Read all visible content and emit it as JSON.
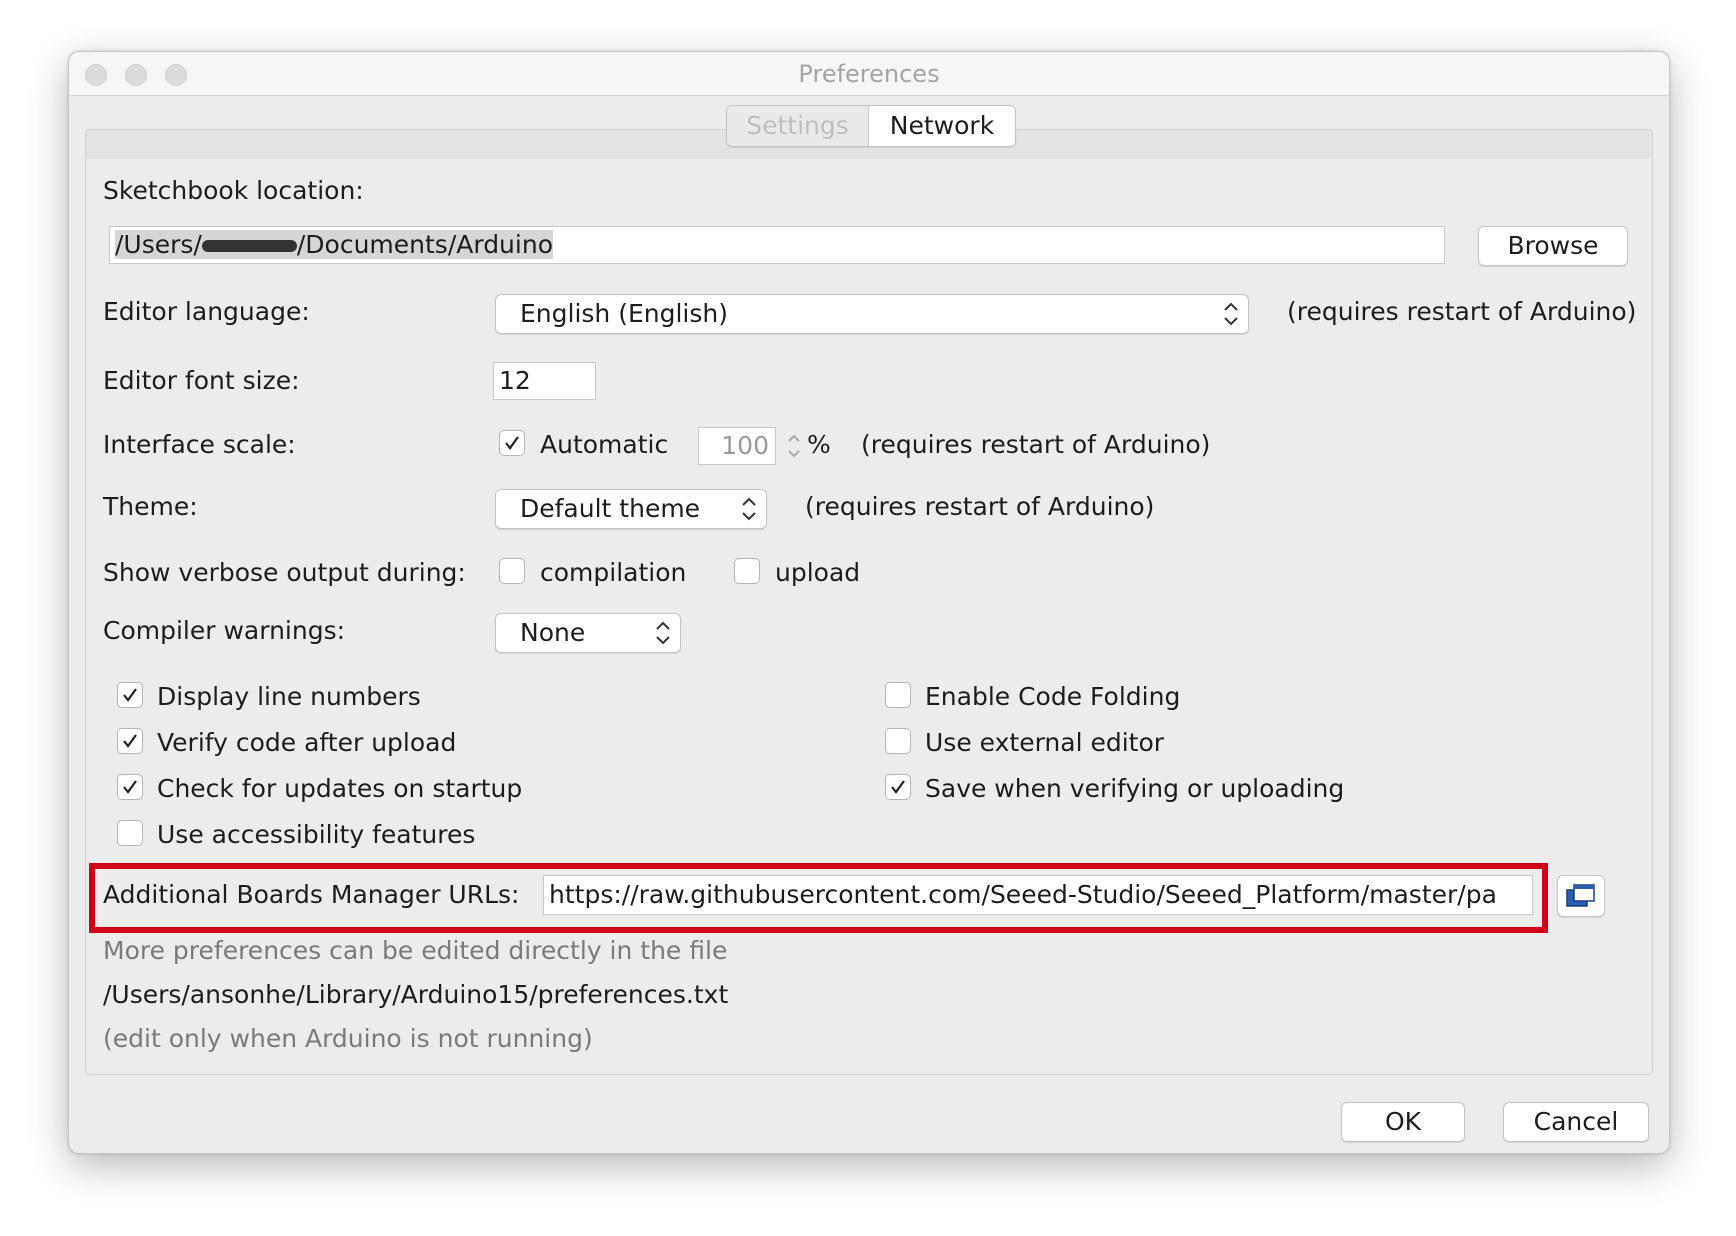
{
  "window": {
    "title": "Preferences"
  },
  "tabs": [
    {
      "label": "Settings",
      "active": false
    },
    {
      "label": "Network",
      "active": true
    }
  ],
  "sketchbook": {
    "label": "Sketchbook location:",
    "path_prefix": "/Users/",
    "path_suffix": "/Documents/Arduino",
    "browse_label": "Browse"
  },
  "editor_language": {
    "label": "Editor language:",
    "value": "English (English)",
    "note": "(requires restart of Arduino)"
  },
  "font_size": {
    "label": "Editor font size:",
    "value": "12"
  },
  "interface_scale": {
    "label": "Interface scale:",
    "automatic_label": "Automatic",
    "automatic_checked": true,
    "value": "100",
    "unit": "%",
    "note": "(requires restart of Arduino)"
  },
  "theme": {
    "label": "Theme:",
    "value": "Default theme",
    "note": "(requires restart of Arduino)"
  },
  "verbose": {
    "label": "Show verbose output during:",
    "compilation_label": "compilation",
    "compilation_checked": false,
    "upload_label": "upload",
    "upload_checked": false
  },
  "compiler_warnings": {
    "label": "Compiler warnings:",
    "value": "None"
  },
  "options_left": [
    {
      "label": "Display line numbers",
      "checked": true
    },
    {
      "label": "Verify code after upload",
      "checked": true
    },
    {
      "label": "Check for updates on startup",
      "checked": true
    },
    {
      "label": "Use accessibility features",
      "checked": false
    }
  ],
  "options_right": [
    {
      "label": "Enable Code Folding",
      "checked": false
    },
    {
      "label": "Use external editor",
      "checked": false
    },
    {
      "label": "Save when verifying or uploading",
      "checked": true
    }
  ],
  "boards_manager": {
    "label": "Additional Boards Manager URLs:",
    "value": "https://raw.githubusercontent.com/Seeed-Studio/Seeed_Platform/master/pa",
    "highlight_color": "#d0021b"
  },
  "info": {
    "line1": "More preferences can be edited directly in the file",
    "line2": "/Users/ansonhe/Library/Arduino15/preferences.txt",
    "line3": "(edit only when Arduino is not running)"
  },
  "buttons": {
    "ok": "OK",
    "cancel": "Cancel"
  },
  "icons": {
    "traffic_lights": "window-control-icon",
    "boards_editor": "window-edit-icon",
    "checkmark": "checkmark-icon",
    "updown": "updown-chevron-icon"
  }
}
